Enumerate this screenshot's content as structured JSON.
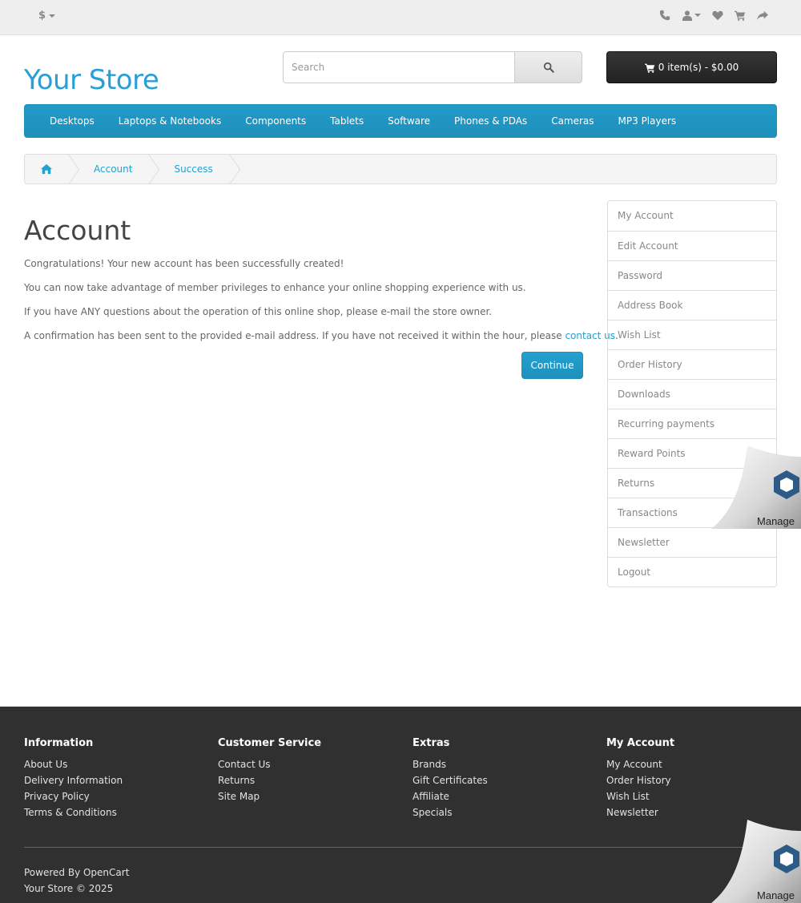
{
  "topbar": {
    "currency": "$",
    "icons": [
      "phone-icon",
      "user-icon",
      "heart-icon",
      "shopping-cart-icon",
      "share-icon"
    ]
  },
  "header": {
    "logo": "Your Store",
    "search_placeholder": "Search",
    "cart_label": "0 item(s) - $0.00"
  },
  "menu": {
    "items": [
      "Desktops",
      "Laptops & Notebooks",
      "Components",
      "Tablets",
      "Software",
      "Phones & PDAs",
      "Cameras",
      "MP3 Players"
    ]
  },
  "breadcrumb": {
    "items": [
      "Account",
      "Success"
    ]
  },
  "content": {
    "title": "Account",
    "p1": "Congratulations! Your new account has been successfully created!",
    "p2": "You can now take advantage of member privileges to enhance your online shopping experience with us.",
    "p3": "If you have ANY questions about the operation of this online shop, please e-mail the store owner.",
    "p4_text": "A confirmation has been sent to the provided e-mail address. If you have not received it within the hour, please ",
    "p4_link": "contact us",
    "p4_end": ".",
    "continue_label": "Continue"
  },
  "sidebar": {
    "items": [
      "My Account",
      "Edit Account",
      "Password",
      "Address Book",
      "Wish List",
      "Order History",
      "Downloads",
      "Recurring payments",
      "Reward Points",
      "Returns",
      "Transactions",
      "Newsletter",
      "Logout"
    ]
  },
  "footer": {
    "columns": [
      {
        "title": "Information",
        "links": [
          "About Us",
          "Delivery Information",
          "Privacy Policy",
          "Terms & Conditions"
        ]
      },
      {
        "title": "Customer Service",
        "links": [
          "Contact Us",
          "Returns",
          "Site Map"
        ]
      },
      {
        "title": "Extras",
        "links": [
          "Brands",
          "Gift Certificates",
          "Affiliate",
          "Specials"
        ]
      },
      {
        "title": "My Account",
        "links": [
          "My Account",
          "Order History",
          "Wish List",
          "Newsletter"
        ]
      }
    ],
    "powered_prefix": "Powered By ",
    "powered_link": "OpenCart",
    "copyright": "Your Store © 2025"
  },
  "manage_label": "Manage",
  "colors": {
    "accent": "#229ac8",
    "link": "#23a1d1",
    "footer_bg": "#303030",
    "cart_bg": "#363636"
  }
}
